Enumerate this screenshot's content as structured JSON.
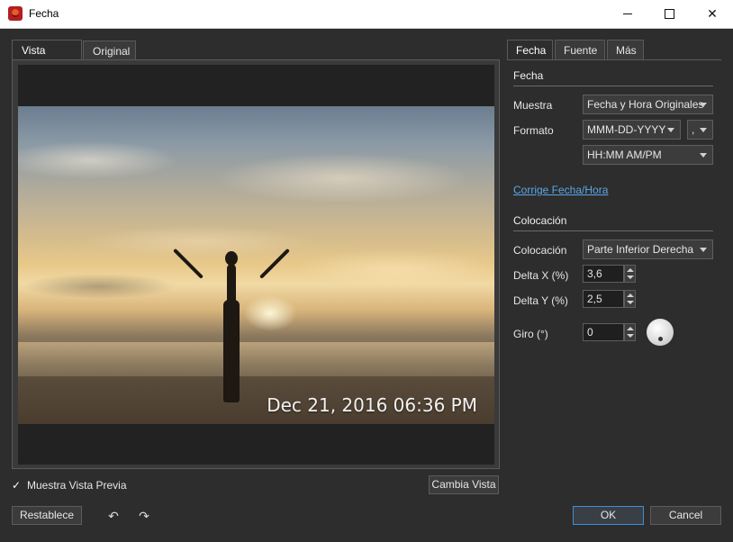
{
  "window": {
    "title": "Fecha"
  },
  "left_tabs": [
    {
      "label": "Vista Previa"
    },
    {
      "label": "Original"
    }
  ],
  "preview": {
    "timestamp_overlay": "Dec 21, 2016 06:36 PM"
  },
  "checkbox": {
    "label": "Muestra Vista Previa",
    "checked": true
  },
  "buttons": {
    "change_view": "Cambia Vista",
    "reset": "Restablece",
    "ok": "OK",
    "cancel": "Cancel"
  },
  "right_tabs": [
    {
      "label": "Fecha"
    },
    {
      "label": "Fuente"
    },
    {
      "label": "Más"
    }
  ],
  "date_section": {
    "title": "Fecha",
    "sample_label": "Muestra",
    "sample_value": "Fecha y Hora Originales",
    "format_label": "Formato",
    "date_format": "MMM-DD-YYYY",
    "separator": ",",
    "time_format": "HH:MM AM/PM",
    "fix_link": "Corrige Fecha/Hora"
  },
  "placement_section": {
    "title": "Colocación",
    "placement_label": "Colocación",
    "placement_value": "Parte Inferior Derecha",
    "delta_x_label": "Delta X (%)",
    "delta_x_value": "3,6",
    "delta_y_label": "Delta Y (%)",
    "delta_y_value": "2,5",
    "rotation_label": "Giro (°)",
    "rotation_value": "0"
  },
  "icons": {
    "app": "app-icon",
    "undo": "undo-arrow-icon",
    "redo": "redo-arrow-icon"
  }
}
